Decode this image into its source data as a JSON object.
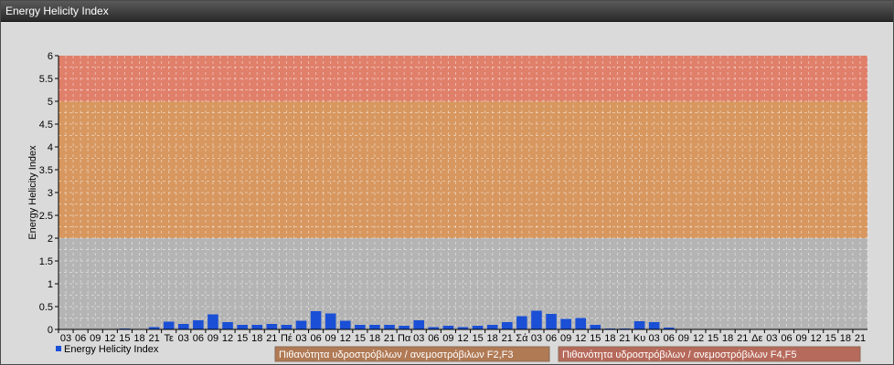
{
  "window": {
    "title": "Energy Helicity Index"
  },
  "chart_data": {
    "type": "bar",
    "ylabel": "Energy Helicity Index",
    "ylim": [
      0,
      6
    ],
    "yticks": [
      "0",
      "0.5",
      "1",
      "1.5",
      "2",
      "2.5",
      "3",
      "3.5",
      "4",
      "4.5",
      "5",
      "5.5",
      "6"
    ],
    "categories": [
      "03",
      "06",
      "09",
      "12",
      "15",
      "18",
      "21",
      "Τε",
      "03",
      "06",
      "09",
      "12",
      "15",
      "18",
      "21",
      "Πέ",
      "03",
      "06",
      "09",
      "12",
      "15",
      "18",
      "21",
      "Πα",
      "03",
      "06",
      "09",
      "12",
      "15",
      "18",
      "21",
      "Σά",
      "03",
      "06",
      "09",
      "12",
      "15",
      "18",
      "21",
      "Κυ",
      "03",
      "06",
      "09",
      "12",
      "15",
      "18",
      "21",
      "Δε",
      "03",
      "06",
      "09",
      "12",
      "15",
      "18",
      "21"
    ],
    "series": [
      {
        "name": "Energy Helicity Index",
        "color": "#1a4fd6",
        "values": [
          0.01,
          0.01,
          0.01,
          0.01,
          0.02,
          0.01,
          0.05,
          0.17,
          0.12,
          0.2,
          0.33,
          0.16,
          0.1,
          0.1,
          0.12,
          0.1,
          0.19,
          0.4,
          0.35,
          0.19,
          0.1,
          0.1,
          0.1,
          0.08,
          0.2,
          0.05,
          0.08,
          0.05,
          0.08,
          0.1,
          0.16,
          0.29,
          0.41,
          0.34,
          0.23,
          0.25,
          0.1,
          0.02,
          0.02,
          0.18,
          0.16,
          0.04,
          0.01,
          0.01,
          0.01,
          0.01,
          0.01,
          0.01,
          0.01,
          0.01,
          0.01,
          0.01,
          0.01,
          0.01,
          0.01
        ]
      }
    ],
    "bands": [
      {
        "from": 0,
        "to": 2,
        "color": "#b4b4b4"
      },
      {
        "from": 2,
        "to": 5,
        "color": "#d7975f",
        "label": "Πιθανότητα υδροστρόβιλων / ανεμοστρόβιλων F2,F3"
      },
      {
        "from": 5,
        "to": 6,
        "color": "#e07f6a",
        "label": "Πιθανότητα υδροστρόβιλων / ανεμοστρόβιλων F4,F5"
      }
    ],
    "legend": {
      "position": "bottom-left"
    },
    "grid": true
  },
  "legend_box_colors": [
    "#b07a55",
    "#b66a5b"
  ]
}
